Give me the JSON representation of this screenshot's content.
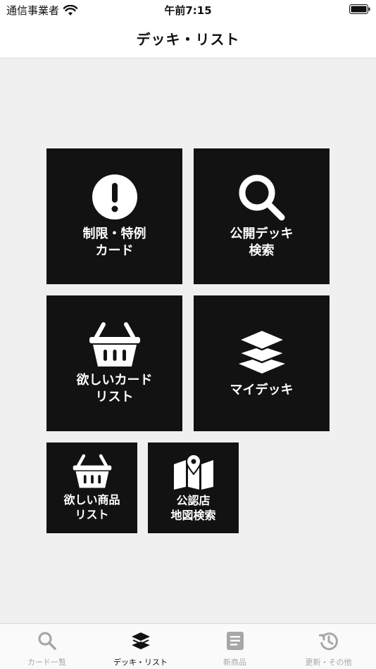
{
  "status_bar": {
    "carrier": "通信事業者",
    "time": "午前7:15"
  },
  "nav": {
    "title": "デッキ・リスト"
  },
  "tiles": {
    "restricted": {
      "label": "制限・特例\nカード",
      "icon": "exclamation-icon"
    },
    "public_deck_search": {
      "label": "公開デッキ\n検索",
      "icon": "search-icon"
    },
    "wish_card_list": {
      "label": "欲しいカード\nリスト",
      "icon": "basket-icon"
    },
    "my_deck": {
      "label": "マイデッキ",
      "icon": "layers-icon"
    },
    "wish_product_list": {
      "label": "欲しい商品\nリスト",
      "icon": "basket-icon"
    },
    "official_store_map": {
      "label": "公認店\n地図検索",
      "icon": "map-icon"
    }
  },
  "tab_bar": {
    "items": [
      {
        "label": "カード一覧",
        "icon": "search-icon",
        "active": false
      },
      {
        "label": "デッキ・リスト",
        "icon": "layers-icon",
        "active": true
      },
      {
        "label": "新商品",
        "icon": "document-icon",
        "active": false
      },
      {
        "label": "更新・その他",
        "icon": "history-icon",
        "active": false
      }
    ]
  },
  "colors": {
    "tile_bg": "#121212",
    "page_bg": "#f0f0f0",
    "tab_inactive": "#a7a7a7",
    "tab_active": "#111111"
  }
}
